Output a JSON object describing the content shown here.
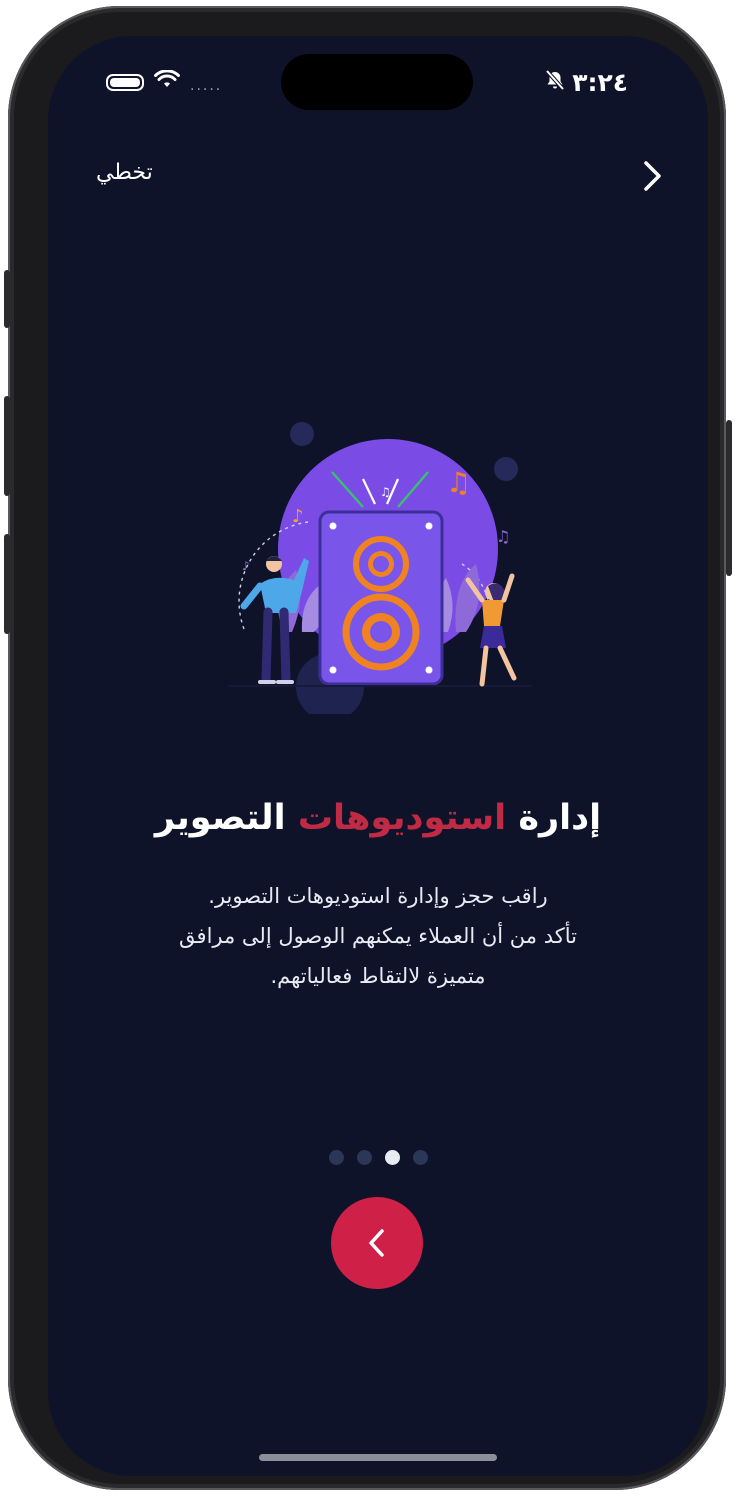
{
  "status_bar": {
    "time": "٣:٢٤",
    "icons": [
      "battery-icon",
      "wifi-icon",
      "bell-slash-icon"
    ],
    "carrier_dots": "....."
  },
  "header": {
    "skip_label": "تخطي",
    "next_icon": "chevron-right-icon"
  },
  "slide": {
    "title_part1": "إدارة",
    "title_accent": "استوديوهات",
    "title_part2": "التصوير",
    "description_lines": [
      "راقب حجز وإدارة استوديوهات التصوير.",
      "تأكد من أن العملاء يمكنهم الوصول إلى مرافق",
      "متميزة لالتقاط فعالياتهم."
    ],
    "illustration": "speaker-dancers-illustration"
  },
  "pagination": {
    "total": 4,
    "active_index": 2
  },
  "fab": {
    "icon": "chevron-left-icon"
  },
  "colors": {
    "background": "#0f132a",
    "accent": "#c12a45",
    "fab": "#cf2148",
    "dot_inactive": "#2b3757",
    "dot_active": "#e9ebf3"
  }
}
